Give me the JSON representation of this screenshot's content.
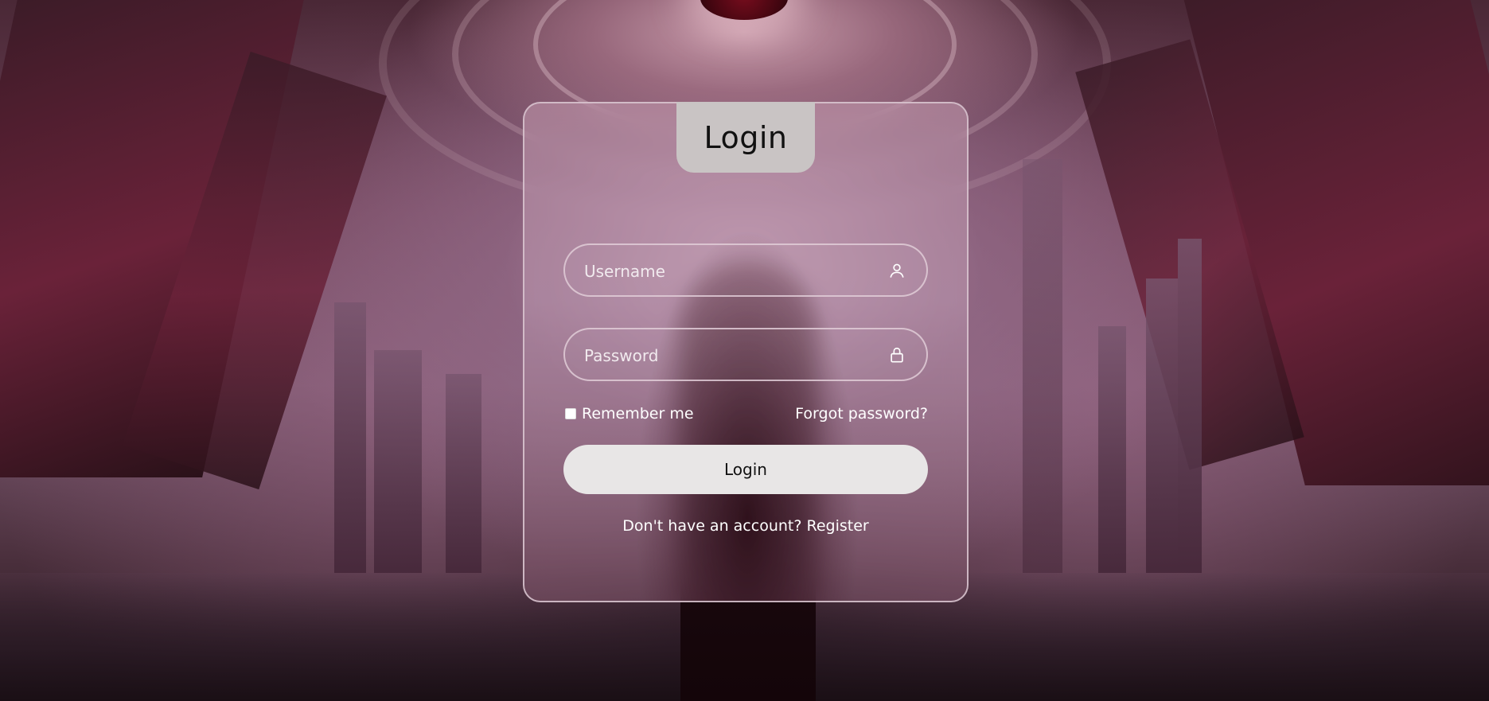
{
  "form": {
    "title": "Login",
    "username": {
      "placeholder": "Username",
      "value": "",
      "icon": "user-icon"
    },
    "password": {
      "placeholder": "Password",
      "value": "",
      "icon": "lock-icon"
    },
    "remember_label": "Remember me",
    "remember_checked": false,
    "forgot_label": "Forgot password?",
    "login_label": "Login",
    "register_prompt": "Don't have an account?",
    "register_link": "Register"
  },
  "colors": {
    "tab_background": "#c9c4c4",
    "button_background": "#e8e6e6",
    "border": "#e1cdd7",
    "text_light": "#ffffff",
    "text_dark": "#111111"
  }
}
